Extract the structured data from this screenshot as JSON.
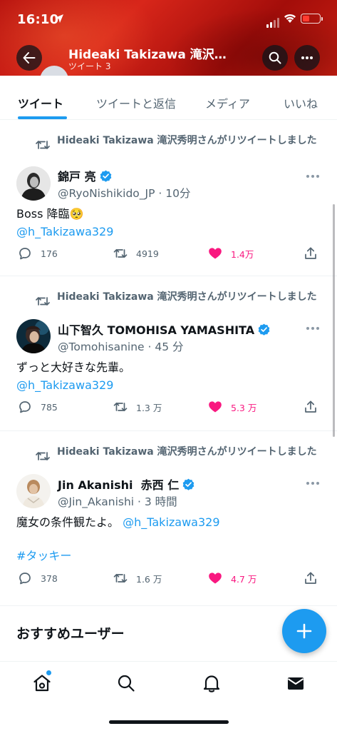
{
  "status_bar": {
    "time": "16:10"
  },
  "header": {
    "title": "Hideaki Takizawa 滝沢…",
    "subtitle": "ツイート 3",
    "icons": [
      "back-arrow-icon",
      "search-icon",
      "more-icon"
    ]
  },
  "tabs": [
    {
      "label": "ツイート",
      "active": true
    },
    {
      "label": "ツイートと返信",
      "active": false
    },
    {
      "label": "メディア",
      "active": false
    },
    {
      "label": "いいね",
      "active": false
    }
  ],
  "tweets": [
    {
      "retweet_line": "Hideaki Takizawa 滝沢秀明さんがリツイートしました",
      "name": "錦戸 亮",
      "handle_time": "@RyoNishikido_JP · 10分",
      "body_line1": "Boss 降臨🥺",
      "body_mention": "@h_Takizawa329",
      "replies": "176",
      "retweets": "4919",
      "likes": "1.4万"
    },
    {
      "retweet_line": "Hideaki Takizawa 滝沢秀明さんがリツイートしました",
      "name": "山下智久 TOMOHISA YAMASHITA",
      "handle_time": "@Tomohisanine · 45 分",
      "body_line1": "ずっと大好きな先輩。",
      "body_mention": "@h_Takizawa329",
      "replies": "785",
      "retweets": "1.3 万",
      "likes": "5.3 万"
    },
    {
      "retweet_line": "Hideaki Takizawa 滝沢秀明さんがリツイートしました",
      "name": "Jin Akanishi  赤西 仁",
      "handle_time": "@Jin_Akanishi · 3 時間",
      "body_line1": "魔女の条件観たよ。",
      "body_mention": "@h_Takizawa329",
      "hashtag": "#タッキー",
      "replies": "378",
      "retweets": "1.6 万",
      "likes": "4.7 万"
    }
  ],
  "recommended": {
    "label": "おすすめユーザー"
  },
  "colors": {
    "accent": "#1d9bf0",
    "like": "#f91880",
    "header_red": "#c81f12",
    "text_secondary": "#536471"
  },
  "bottom_nav": [
    "home-icon",
    "search-icon",
    "bell-icon",
    "mail-icon"
  ]
}
